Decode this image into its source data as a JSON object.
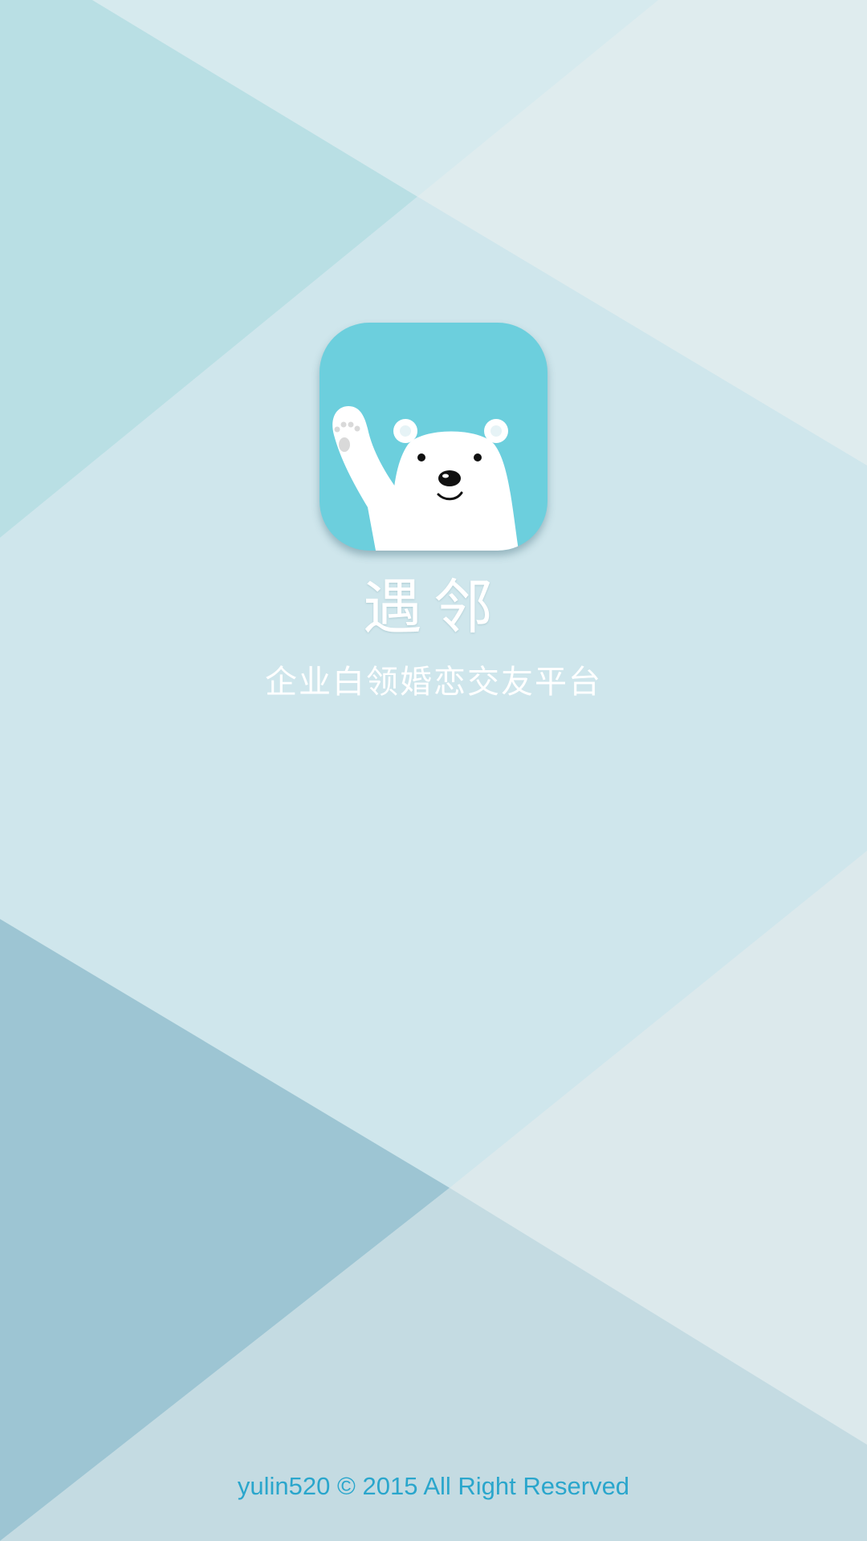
{
  "app_name": "遇邻",
  "tagline": "企业白领婚恋交友平台",
  "copyright": "yulin520 © 2015 All Right Reserved",
  "logo_icon": "polar-bear-waving-icon",
  "colors": {
    "background": "#cfe6ec",
    "icon_background": "#6ccfdd",
    "copyright_text": "#2aa6cc",
    "title_text": "#ffffff"
  }
}
